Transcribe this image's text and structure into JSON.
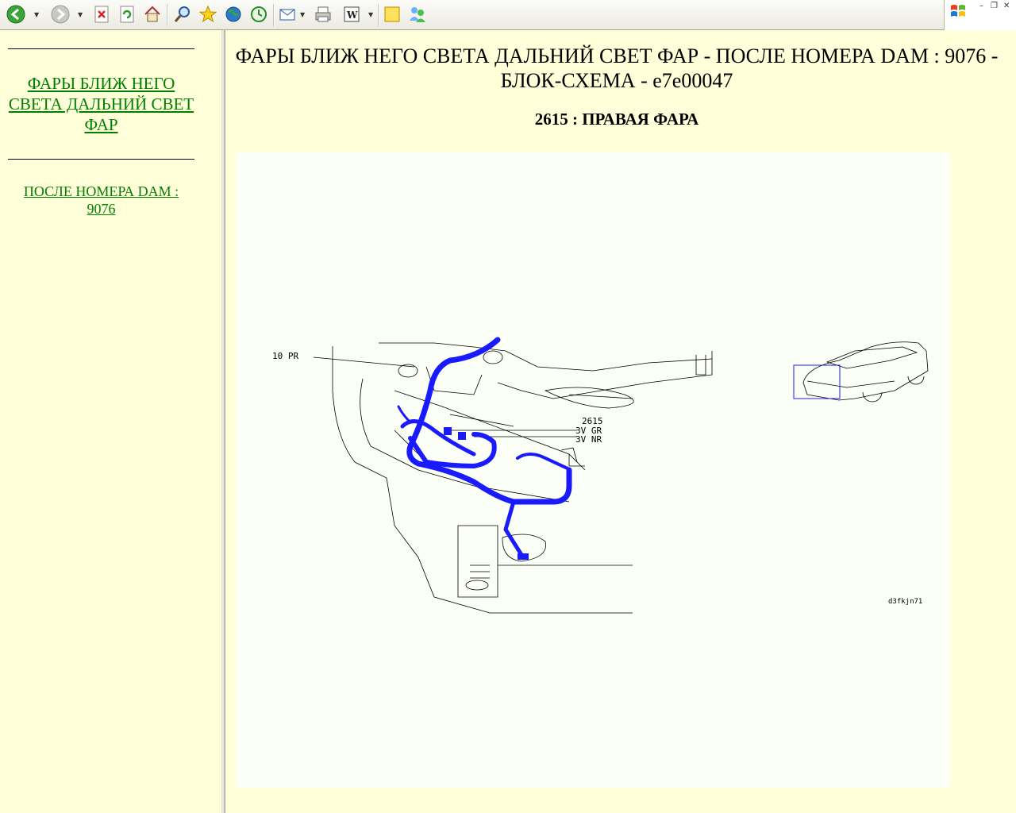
{
  "toolbar": {
    "buttons": [
      {
        "name": "back-button",
        "icon": "back-arrow-icon"
      },
      {
        "name": "forward-button",
        "icon": "forward-arrow-icon"
      },
      {
        "name": "stop-button",
        "icon": "stop-icon"
      },
      {
        "name": "refresh-button",
        "icon": "refresh-icon"
      },
      {
        "name": "home-button",
        "icon": "home-icon"
      },
      {
        "name": "search-button",
        "icon": "search-icon"
      },
      {
        "name": "favorites-button",
        "icon": "star-icon"
      },
      {
        "name": "media-button",
        "icon": "globe-icon"
      },
      {
        "name": "history-button",
        "icon": "history-icon"
      },
      {
        "name": "mail-button",
        "icon": "mail-icon"
      },
      {
        "name": "print-button",
        "icon": "printer-icon"
      },
      {
        "name": "edit-button",
        "icon": "word-icon"
      },
      {
        "name": "discuss-button",
        "icon": "note-icon"
      },
      {
        "name": "messenger-button",
        "icon": "messenger-icon"
      }
    ],
    "colors": {
      "link": "#008000",
      "background": "#ffffd9",
      "wire": "#1a1aff"
    }
  },
  "nav": {
    "link1": "ФАРЫ БЛИЖ НЕГО СВЕТА ДАЛЬНИЙ СВЕТ ФАР",
    "link2": "ПОСЛЕ НОМЕРА DAM : 9076"
  },
  "content": {
    "title": "ФАРЫ БЛИЖ НЕГО СВЕТА ДАЛЬНИЙ СВЕТ ФАР - ПОСЛЕ НОМЕРА DAM : 9076 - БЛОК-СХЕМА - e7e00047",
    "subtitle": "2615 : ПРАВАЯ ФАРА",
    "diagram": {
      "label_pr": "10  PR",
      "label_connector": "2615",
      "label_gr": "3V  GR",
      "label_nr": "3V  NR",
      "label_ref": "d3fkjn71"
    }
  }
}
